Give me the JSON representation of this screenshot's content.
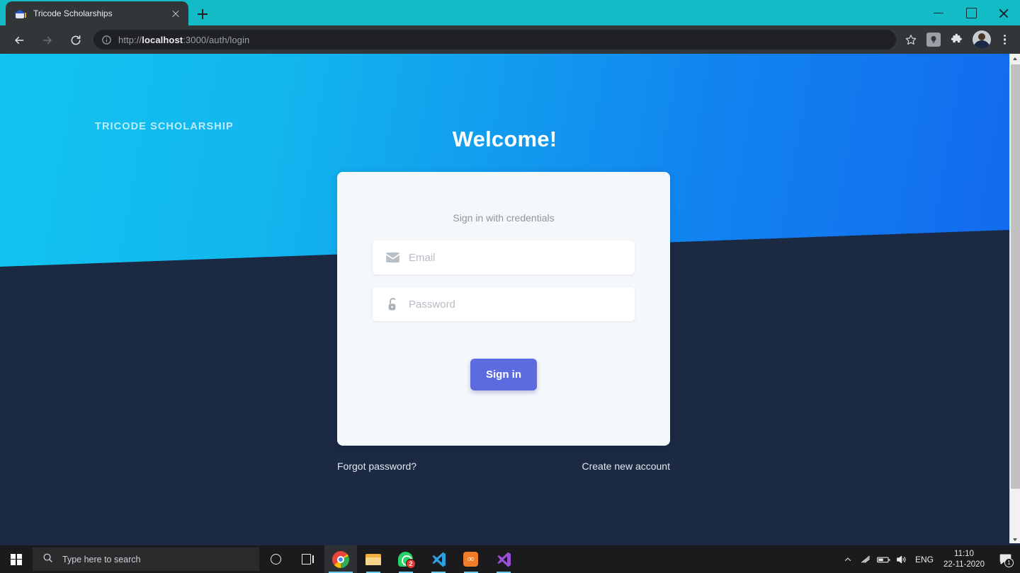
{
  "browser": {
    "tab": {
      "title": "Tricode Scholarships",
      "favicon": "graduation-cap-icon",
      "close_icon": "close-icon"
    },
    "new_tab_icon": "plus-icon",
    "window_controls": {
      "minimize": "minimize-icon",
      "maximize": "maximize-icon",
      "close": "close-icon"
    },
    "toolbar": {
      "back_icon": "back-arrow-icon",
      "forward_icon": "forward-arrow-icon",
      "reload_icon": "reload-icon",
      "site_info_icon": "info-circle-icon",
      "url_scheme": "http://",
      "url_host": "localhost",
      "url_rest": ":3000/auth/login",
      "bookmark_icon": "star-icon",
      "extension_lamp_icon": "lamp-icon",
      "extension_puzzle_icon": "puzzle-icon",
      "profile_icon": "avatar-icon",
      "menu_icon": "three-dots-vertical-icon"
    }
  },
  "page": {
    "brand": "TRICODE SCHOLARSHIP",
    "heading": "Welcome!",
    "card": {
      "subtitle": "Sign in with credentials",
      "email": {
        "icon": "envelope-icon",
        "placeholder": "Email",
        "value": ""
      },
      "password": {
        "icon": "unlocked-padlock-icon",
        "placeholder": "Password",
        "value": ""
      },
      "submit_label": "Sign in"
    },
    "links": {
      "forgot": "Forgot password?",
      "create": "Create new account"
    },
    "colors": {
      "gradient_start": "#11C5F0",
      "gradient_end": "#1269EE",
      "dark_background": "#1B2942",
      "card_background": "#F5F8FB",
      "button": "#5C6BE0"
    },
    "scrollbar": {
      "up_icon": "scroll-up-arrow-icon",
      "down_icon": "scroll-down-arrow-icon"
    }
  },
  "taskbar": {
    "start_icon": "windows-logo-icon",
    "search_icon": "search-icon",
    "search_placeholder": "Type here to search",
    "cortana_icon": "cortana-icon",
    "task_view_icon": "task-view-icon",
    "apps": [
      {
        "name": "chrome-icon",
        "label": "Google Chrome",
        "badge": ""
      },
      {
        "name": "file-explorer-icon",
        "label": "File Explorer",
        "badge": ""
      },
      {
        "name": "whatsapp-icon",
        "label": "WhatsApp",
        "badge": "2"
      },
      {
        "name": "vscode-icon",
        "label": "Visual Studio Code",
        "badge": ""
      },
      {
        "name": "xampp-icon",
        "label": "XAMPP",
        "badge": ""
      },
      {
        "name": "visual-studio-icon",
        "label": "Visual Studio",
        "badge": ""
      }
    ],
    "tray": {
      "overflow_icon": "chevron-up-icon",
      "network_icon": "wifi-icon",
      "battery_icon": "battery-icon",
      "volume_icon": "speaker-icon",
      "language": "ENG",
      "time": "11:10",
      "date": "22-11-2020",
      "notification_icon": "action-center-icon",
      "notification_count": "1"
    }
  }
}
